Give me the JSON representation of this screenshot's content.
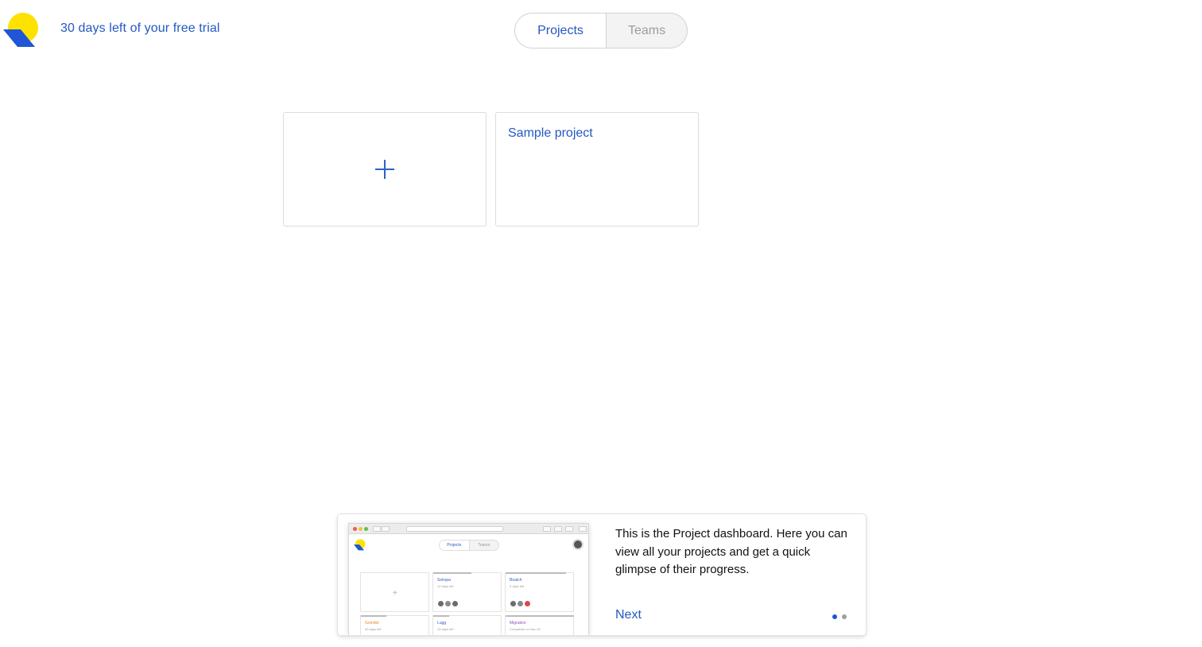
{
  "header": {
    "trial_text": "30 days left of your free trial",
    "tabs": [
      {
        "label": "Projects",
        "active": true
      },
      {
        "label": "Teams",
        "active": false
      }
    ]
  },
  "projects": {
    "new_project_icon": "plus-icon",
    "items": [
      {
        "title": "Sample project"
      }
    ]
  },
  "tour": {
    "text": "This is the Project dashboard. Here you can view all your projects and get a quick glimpse of their progress.",
    "next_label": "Next",
    "page_count": 2,
    "current_page": 1,
    "preview": {
      "url": "hello.personalmap.com",
      "tabs": [
        "Projects",
        "Teams"
      ],
      "cards": [
        {
          "title": "Sekopa",
          "subtitle": "12 days left"
        },
        {
          "title": "Beatch",
          "subtitle": "5 days left"
        },
        {
          "title": "Gomdol",
          "subtitle": "30 days left"
        },
        {
          "title": "Lugg",
          "subtitle": "15 days left"
        },
        {
          "title": "Migration",
          "subtitle": "Completed on Nov 05"
        }
      ]
    }
  },
  "colors": {
    "brand_blue": "#2458c2",
    "logo_yellow": "#fde200",
    "logo_blue": "#1f55d6",
    "pager_active": "#1f55d6",
    "pager_inactive": "#9e9e9e"
  }
}
